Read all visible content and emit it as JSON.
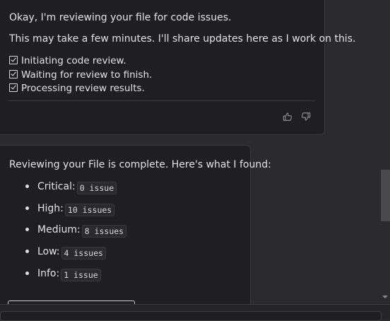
{
  "messages": {
    "first": {
      "line1": "Okay, I'm reviewing your file for code issues.",
      "line2": "This may take a few minutes. I'll share updates here as I work on this.",
      "checklist": [
        "Initiating code review.",
        "Waiting for review to finish.",
        "Processing review results."
      ],
      "feedback": {
        "up_icon": "thumbs-up-icon",
        "down_icon": "thumbs-down-icon"
      }
    },
    "second": {
      "intro": "Reviewing your File is complete. Here's what I found:",
      "findings": [
        {
          "label": "Critical:",
          "count": "0 issue"
        },
        {
          "label": "High:",
          "count": "10 issues"
        },
        {
          "label": "Medium:",
          "count": "8 issues"
        },
        {
          "label": "Low:",
          "count": "4 issues"
        },
        {
          "label": "Info:",
          "count": "1 issue"
        }
      ]
    }
  },
  "colors": {
    "background": "#2b2b2d",
    "bubble": "#1f1f21",
    "text": "#e3e3e3",
    "muted_icon": "#8e8e92"
  }
}
